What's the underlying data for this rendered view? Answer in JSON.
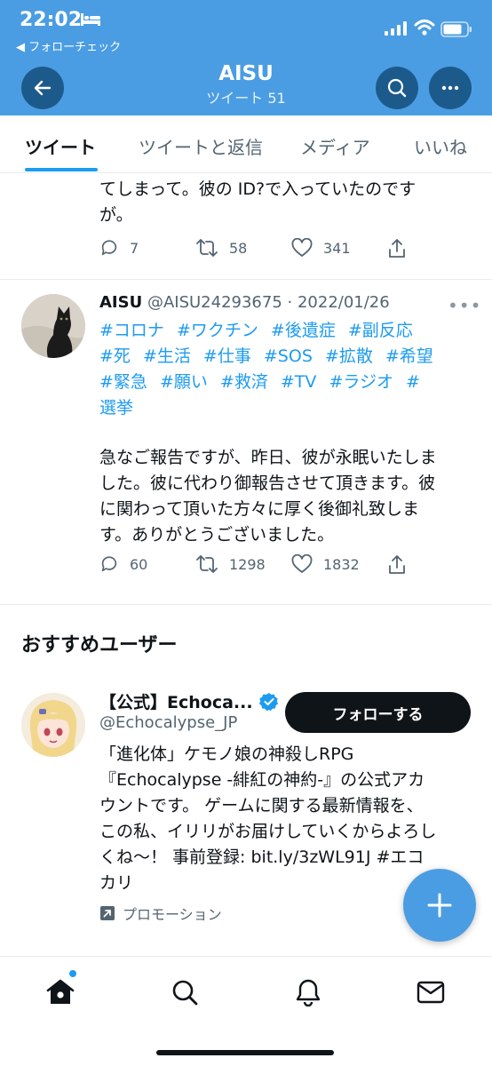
{
  "status_bar": {
    "time": "22:02",
    "back_app": "◀ フォローチェック"
  },
  "header": {
    "name": "AISU",
    "tweet_count": "ツイート 51"
  },
  "tabs": [
    {
      "label": "ツイート",
      "active": true
    },
    {
      "label": "ツイートと返信",
      "active": false
    },
    {
      "label": "メディア",
      "active": false
    },
    {
      "label": "いいね",
      "active": false
    }
  ],
  "tweet1": {
    "text_lines": [
      "てしまって。彼の ID?で入っていたのです",
      "が。"
    ],
    "replies": "7",
    "retweets": "58",
    "likes": "341"
  },
  "tweet2": {
    "name": "AISU",
    "handle_date": "@AISU24293675 · 2022/01/26",
    "hashtag_lines": [
      "#コロナ #ワクチン #後遺症 #副反応",
      "#死 #生活 #仕事 #SOS #拡散 #希望",
      "#緊急 #願い #救済 #TV #ラジオ #",
      "選挙"
    ],
    "body_lines": [
      "急なご報告ですが、昨日、彼が永眠いたしま",
      "した。彼に代わり御報告させて頂きます。彼",
      "に関わって頂いた方々に厚く後御礼致しま",
      "す。ありがとうございました。"
    ],
    "replies": "60",
    "retweets": "1298",
    "likes": "1832"
  },
  "suggested": {
    "title": "おすすめユーザー",
    "name": "【公式】Echoca...",
    "handle": "@Echocalypse_JP",
    "follow_label": "フォローする",
    "bio_lines": [
      "「進化体」ケモノ娘の神殺しRPG",
      "『Echocalypse -緋紅の神約-』の公式アカ",
      "ウントです。 ゲームに関する最新情報を、",
      "この私、イリリがお届けしていくからよろし",
      "くね～！ 事前登録: bit.ly/3zWL91J #エコ",
      "カリ"
    ],
    "promo_label": "プロモーション"
  },
  "colors": {
    "header_blue": "#4a9de2",
    "link_blue": "#1d9bf0",
    "verified_blue": "#1d9bf0"
  }
}
